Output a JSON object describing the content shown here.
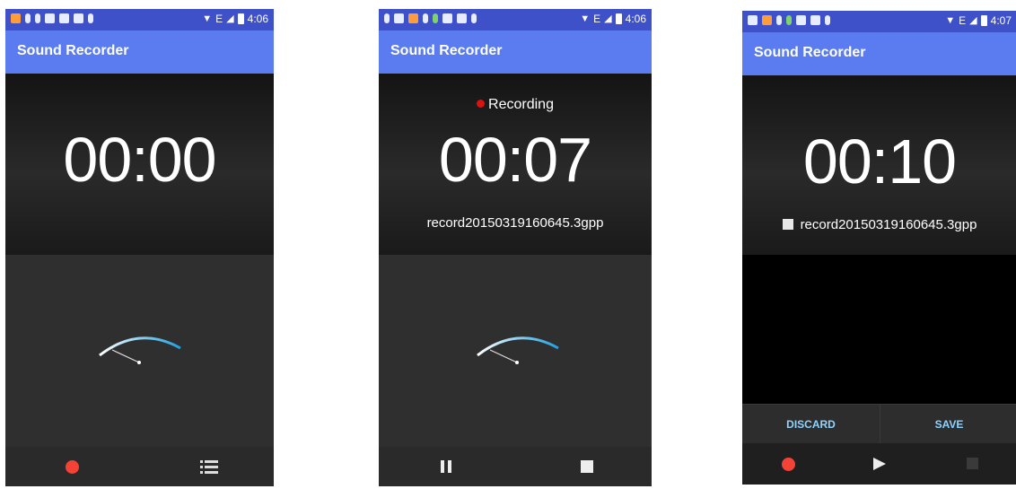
{
  "screens": [
    {
      "status": {
        "network": "E",
        "time": "4:06"
      },
      "app_title": "Sound Recorder",
      "timer": "00:00",
      "controls": {
        "left": "record-icon",
        "right": "list-icon"
      }
    },
    {
      "status": {
        "network": "E",
        "time": "4:06"
      },
      "app_title": "Sound Recorder",
      "recording_label": "Recording",
      "timer": "00:07",
      "filename": "record20150319160645.3gpp",
      "controls": {
        "left": "pause-icon",
        "right": "stop-icon"
      }
    },
    {
      "status": {
        "network": "E",
        "time": "4:07"
      },
      "app_title": "Sound Recorder",
      "timer": "00:10",
      "filename": "record20150319160645.3gpp",
      "actions": {
        "discard": "DISCARD",
        "save": "SAVE"
      },
      "controls": {
        "left": "record-icon",
        "middle": "play-icon",
        "right": "stop-icon-disabled"
      }
    }
  ],
  "colors": {
    "status_bar": "#3f51c9",
    "app_bar": "#5a7cf0",
    "record_red": "#f44336",
    "action_text": "#8fd3ff",
    "vu_arc": "#33b5e5"
  }
}
